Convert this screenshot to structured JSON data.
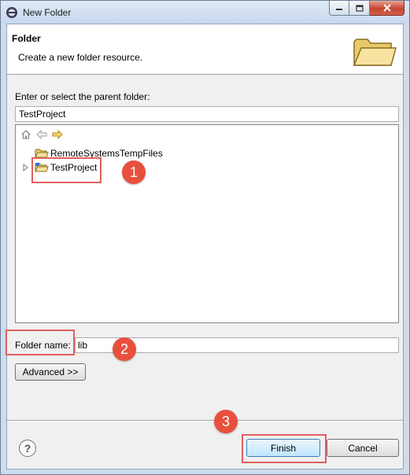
{
  "window": {
    "title": "New Folder",
    "controls": [
      "minimize",
      "maximize",
      "close"
    ]
  },
  "header": {
    "title": "Folder",
    "description": "Create a new folder resource."
  },
  "parent_folder": {
    "label": "Enter or select the parent folder:",
    "value": "TestProject"
  },
  "tree": {
    "nav_icons": [
      "home-icon",
      "back-arrow-icon",
      "forward-arrow-icon"
    ],
    "items": [
      {
        "label": "RemoteSystemsTempFiles",
        "icon": "folder-icon",
        "expandable": false
      },
      {
        "label": "TestProject",
        "icon": "project-folder-icon",
        "expandable": true,
        "selected": true
      }
    ]
  },
  "folder_name": {
    "label": "Folder name:",
    "value": "lib"
  },
  "buttons": {
    "advanced": "Advanced >>",
    "finish": "Finish",
    "cancel": "Cancel",
    "help": "?"
  },
  "annotations": {
    "step1": "1",
    "step2": "2",
    "step3": "3",
    "color": "#e8503e"
  }
}
